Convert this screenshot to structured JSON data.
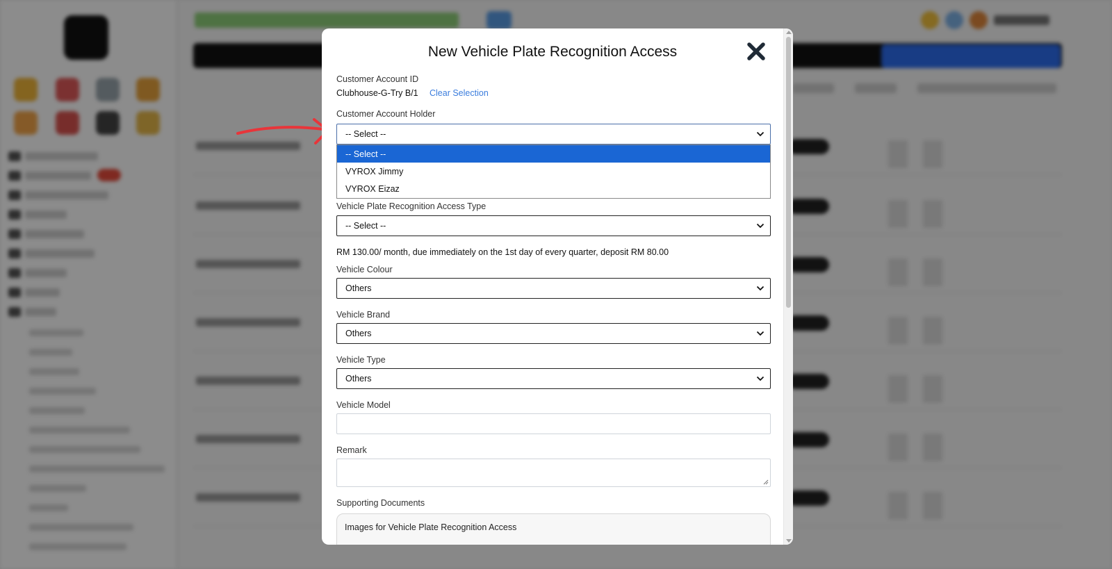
{
  "modal": {
    "title": "New Vehicle Plate Recognition Access",
    "close_icon": "close-icon",
    "customer_account_id": {
      "label": "Customer Account ID",
      "value": "Clubhouse-G-Try B/1",
      "clear_link": "Clear Selection"
    },
    "customer_account_holder": {
      "label": "Customer Account Holder",
      "selected": "-- Select --",
      "options": [
        "-- Select --",
        "VYROX Jimmy",
        "VYROX Eizaz"
      ]
    },
    "access_type": {
      "label": "Vehicle Plate Recognition Access Type",
      "selected": "-- Select --"
    },
    "pricing_note": "RM 130.00/ month, due immediately on the 1st day of every quarter, deposit RM 80.00",
    "vehicle_colour": {
      "label": "Vehicle Colour",
      "selected": "Others"
    },
    "vehicle_brand": {
      "label": "Vehicle Brand",
      "selected": "Others"
    },
    "vehicle_type": {
      "label": "Vehicle Type",
      "selected": "Others"
    },
    "vehicle_model": {
      "label": "Vehicle Model",
      "value": ""
    },
    "remark": {
      "label": "Remark",
      "value": ""
    },
    "supporting_documents": {
      "label": "Supporting Documents",
      "upload_text": "Images for Vehicle Plate Recognition Access"
    }
  },
  "colors": {
    "overlay": "#000000",
    "selected_option": "#1a66d4",
    "link": "#3b7ddd",
    "annotation_arrow": "#e8353a"
  }
}
